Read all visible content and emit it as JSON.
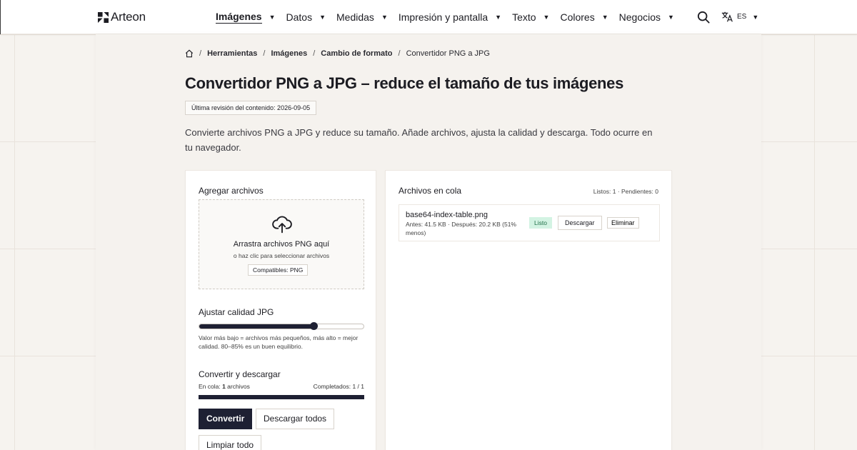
{
  "header": {
    "brand": "Arteon",
    "nav": [
      {
        "label": "Imágenes",
        "active": true
      },
      {
        "label": "Datos",
        "active": false
      },
      {
        "label": "Medidas",
        "active": false
      },
      {
        "label": "Impresión y pantalla",
        "active": false
      },
      {
        "label": "Texto",
        "active": false
      },
      {
        "label": "Colores",
        "active": false
      },
      {
        "label": "Negocios",
        "active": false
      }
    ],
    "language": "ES",
    "icons": {
      "search": "search-icon",
      "language": "translate-icon",
      "caret": "caret-down-icon"
    }
  },
  "breadcrumb": {
    "home_icon": "home-icon",
    "items": [
      "Herramientas",
      "Imágenes",
      "Cambio de formato"
    ],
    "current": "Convertidor PNG a JPG"
  },
  "page": {
    "title": "Convertidor PNG a JPG – reduce el tamaño de tus imágenes",
    "revision": "Última revisión del contenido: 2026-09-05",
    "intro": "Convierte archivos PNG a JPG y reduce su tamaño. Añade archivos, ajusta la calidad y descarga. Todo ocurre en tu navegador."
  },
  "add_files": {
    "title": "Agregar archivos",
    "drop_title": "Arrastra archivos PNG aquí",
    "drop_sub": "o haz clic para seleccionar archivos",
    "compatible": "Compatibles: PNG",
    "icon": "cloud-upload-icon"
  },
  "quality": {
    "title": "Ajustar calidad JPG",
    "value": 0.7,
    "hint": "Valor más bajo = archivos más pequeños, más alto = mejor calidad. 80–85% es un buen equilibrio."
  },
  "convert": {
    "title": "Convertir y descargar",
    "queue_prefix": "En cola: ",
    "queue_count": "1",
    "queue_suffix": " archivos",
    "completed": "Completados: 1 / 1",
    "progress": 1.0,
    "convert_label": "Convertir",
    "download_all_label": "Descargar todos",
    "clear_label": "Limpiar todo"
  },
  "queue": {
    "title": "Archivos en cola",
    "stats": "Listos: 1 · Pendientes: 0",
    "files": [
      {
        "name": "base64-index-table.png",
        "meta": "Antes: 41.5 KB · Después: 20.2 KB (51% menos)",
        "status": "Listo",
        "download_label": "Descargar",
        "remove_label": "Eliminar"
      }
    ]
  },
  "colors": {
    "accent": "#1e2033",
    "ready_bg": "#d3f3e3",
    "ready_fg": "#1f6e47",
    "page_bg": "#f6f3ef"
  }
}
